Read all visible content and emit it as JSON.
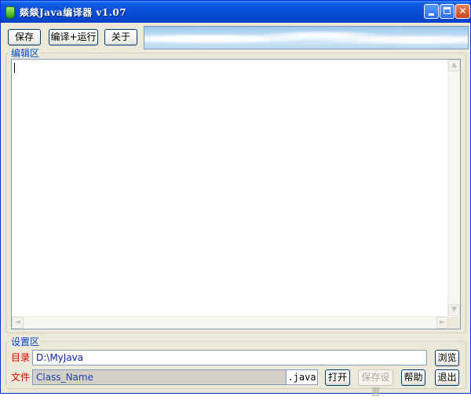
{
  "window": {
    "title": "燚燚Java编译器 v1.07",
    "controls": {
      "minimize": "minimize",
      "maximize": "maximize",
      "close": "✕"
    }
  },
  "toolbar": {
    "save_label": "保存",
    "compile_run_label": "编译+运行",
    "about_label": "关于"
  },
  "editor": {
    "group_label": "编辑区",
    "content": "",
    "scroll_up": "▲",
    "scroll_down": "▼",
    "scroll_left": "◄",
    "scroll_right": "►"
  },
  "settings": {
    "group_label": "设置区",
    "directory": {
      "label": "目录",
      "value": "D:\\MyJava"
    },
    "browse_label": "浏览",
    "file": {
      "label": "文件",
      "value": "Class_Name",
      "extension": ".java"
    },
    "open_label": "打开",
    "save_settings_label": "保存设置",
    "save_settings_enabled": false,
    "help_label": "帮助",
    "exit_label": "退出"
  },
  "colors": {
    "title_bar": "#0a4fd8",
    "group_label": "#0046d5",
    "field_label": "#e00000",
    "window_bg": "#ece9d8"
  }
}
